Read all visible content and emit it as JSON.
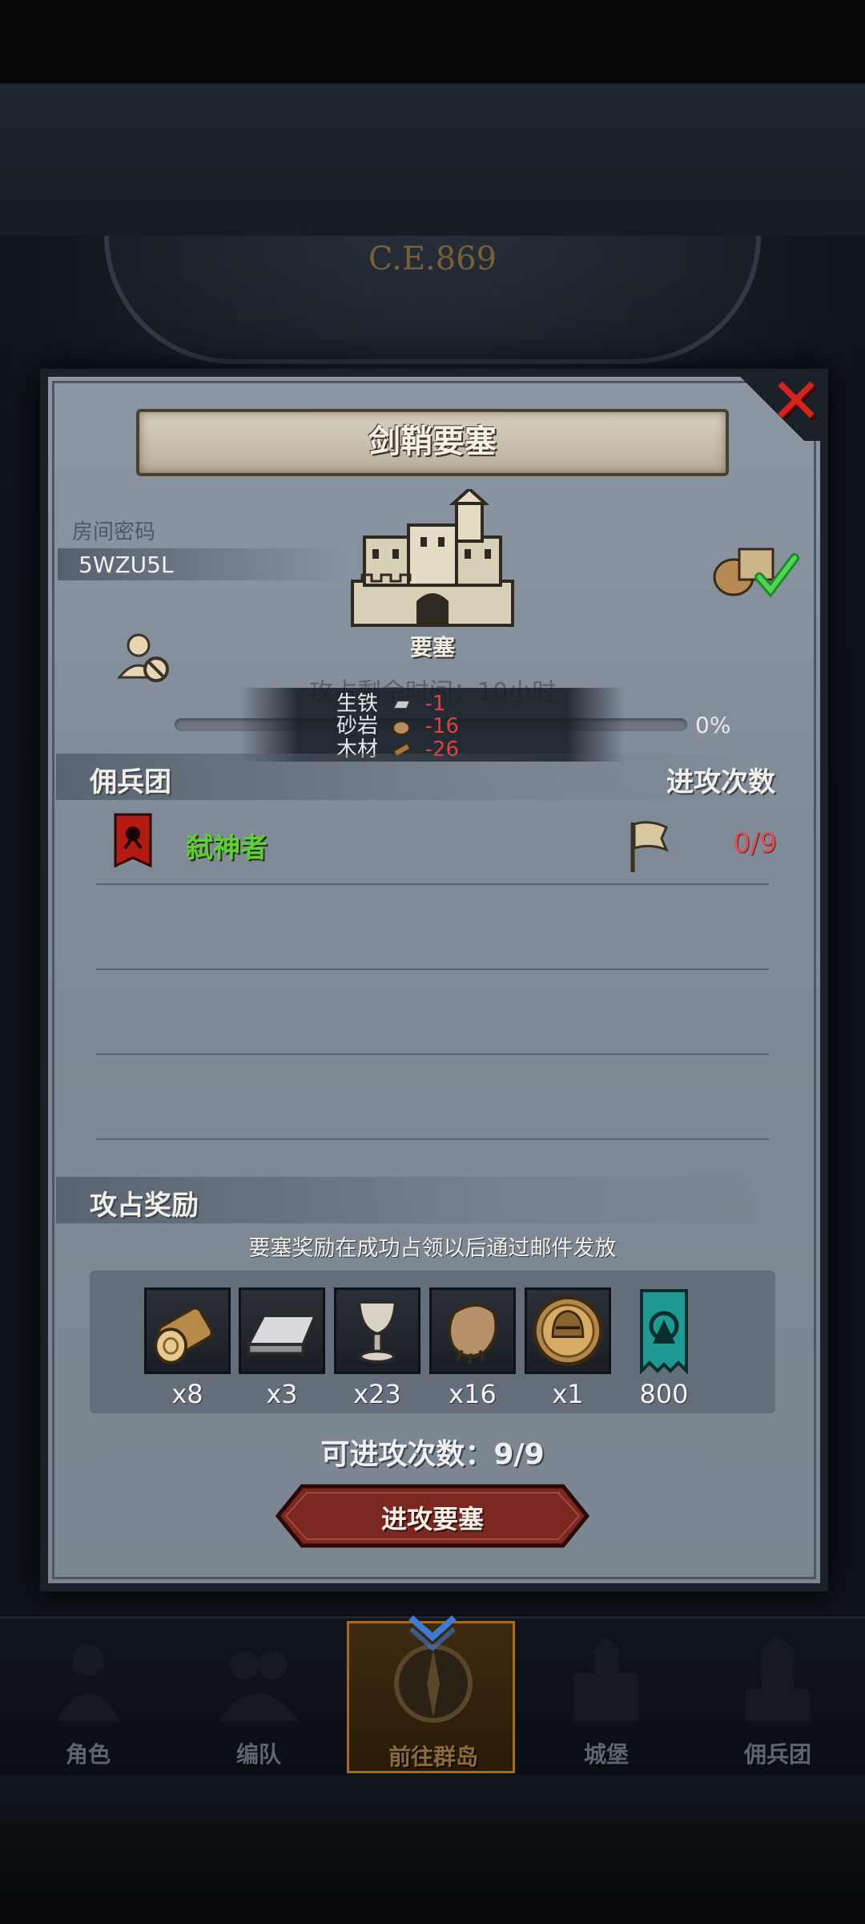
{
  "era": "C.E.869",
  "dialog": {
    "title": "剑鞘要塞",
    "room_code_label": "房间密码",
    "room_code": "5WZU5L",
    "building_label": "要塞",
    "capture_time": "攻占剩余时间：10小时",
    "progress_percent": "0%",
    "progress_value": 0,
    "costs": [
      {
        "name": "生铁",
        "value": "-1",
        "icon": "iron-icon"
      },
      {
        "name": "砂岩",
        "value": "-16",
        "icon": "sandstone-icon"
      },
      {
        "name": "木材",
        "value": "-26",
        "icon": "wood-icon"
      }
    ],
    "mercenary_section": {
      "title": "佣兵团",
      "right_title": "进攻次数",
      "rows": [
        {
          "name": "弑神者",
          "count": "0/9"
        }
      ]
    },
    "reward_section": {
      "title": "攻占奖励",
      "note": "要塞奖励在成功占领以后通过邮件发放",
      "items": [
        {
          "icon": "log-icon",
          "qty": "x8"
        },
        {
          "icon": "iron-ingot-icon",
          "qty": "x3"
        },
        {
          "icon": "goblet-icon",
          "qty": "x23"
        },
        {
          "icon": "fur-pelt-icon",
          "qty": "x16"
        },
        {
          "icon": "helmet-medal-icon",
          "qty": "x1"
        },
        {
          "icon": "teal-banner-icon",
          "qty": "800"
        }
      ]
    },
    "attacks_left": "可进攻次数：9/9",
    "attack_button": "进攻要塞"
  },
  "nav": {
    "items": [
      {
        "label": "角色",
        "icon": "knight-icon"
      },
      {
        "label": "编队",
        "icon": "formation-icon"
      },
      {
        "label": "前往群岛",
        "icon": "compass-icon",
        "active": true
      },
      {
        "label": "城堡",
        "icon": "castle-icon"
      },
      {
        "label": "佣兵团",
        "icon": "mercenary-tower-icon"
      }
    ]
  },
  "colors": {
    "accent_red": "#d5241c",
    "merc_green": "#5fcf38",
    "count_red": "#e94a4a",
    "nav_active": "#a86a16"
  }
}
